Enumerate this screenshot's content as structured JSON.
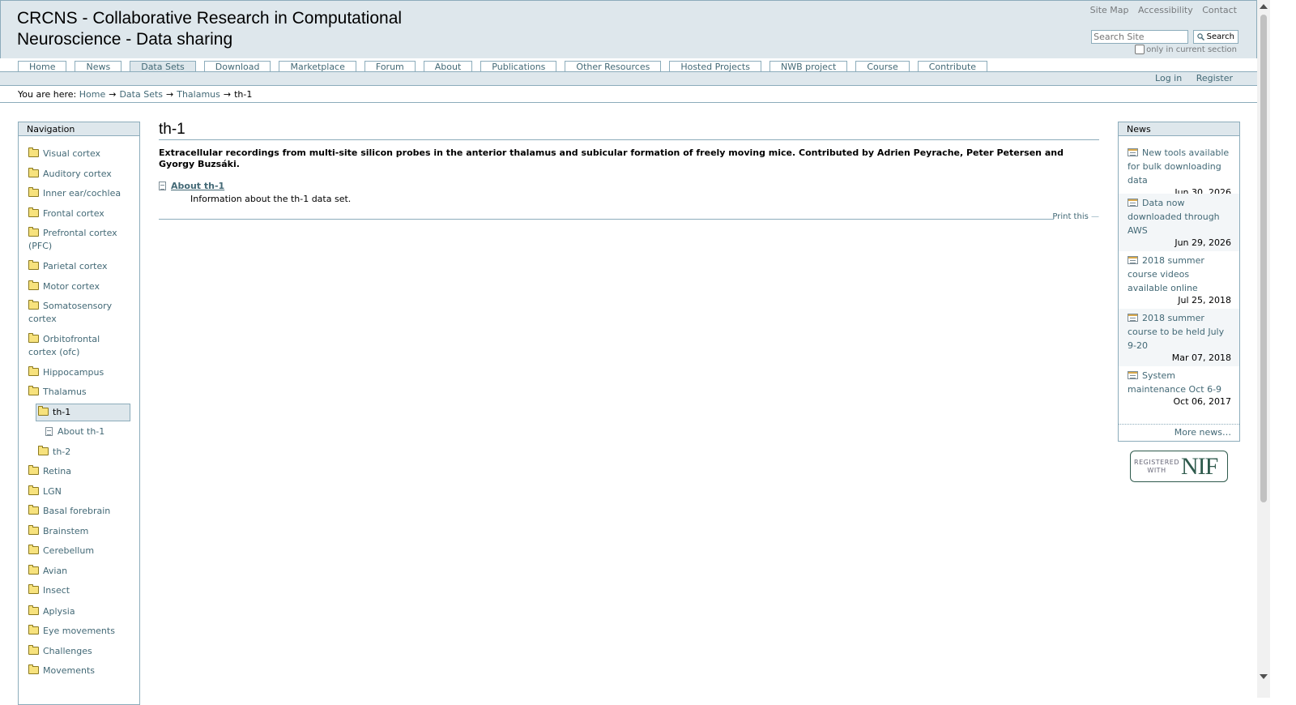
{
  "site": {
    "title": "CRCNS - Collaborative Research in Computational Neuroscience - Data sharing",
    "actions": [
      "Site Map",
      "Accessibility",
      "Contact"
    ],
    "search_placeholder": "Search Site",
    "search_button": "Search",
    "search_option": "only in current section"
  },
  "tabs": [
    "Home",
    "News",
    "Data Sets",
    "Download",
    "Marketplace",
    "Forum",
    "About",
    "Publications",
    "Other Resources",
    "Hosted Projects",
    "NWB project",
    "Course",
    "Contribute"
  ],
  "selected_tab": "Data Sets",
  "personal_bar": {
    "login": "Log in",
    "register": "Register"
  },
  "breadcrumb": {
    "label": "You are here:",
    "items": [
      "Home",
      "Data Sets",
      "Thalamus",
      "th-1"
    ],
    "separator": "→"
  },
  "navigation": {
    "header": "Navigation",
    "items": [
      "Visual cortex",
      "Auditory cortex",
      "Inner ear/cochlea",
      "Frontal cortex",
      "Prefrontal cortex (PFC)",
      "Parietal cortex",
      "Motor cortex",
      "Somatosensory cortex",
      "Orbitofrontal cortex (ofc)",
      "Hippocampus",
      "Thalamus",
      "th-1",
      "About th-1",
      "th-2",
      "Retina",
      "LGN",
      "Basal forebrain",
      "Brainstem",
      "Cerebellum",
      "Avian",
      "Insect",
      "Aplysia",
      "Eye movements",
      "Challenges",
      "Movements"
    ]
  },
  "content": {
    "title": "th-1",
    "description": "Extracellular recordings from multi-site silicon probes in the anterior thalamus and subicular formation of freely moving mice. Contributed by Adrien Peyrache, Peter Petersen and Gyorgy Buzsáki.",
    "about_link": "About th-1",
    "about_description": "Information about the th-1 data set.",
    "print_label": "Print this"
  },
  "news": {
    "header": "News",
    "items": [
      {
        "title": "New tools available for bulk downloading data",
        "date": "Jun 30, 2026"
      },
      {
        "title": "Data now downloaded through AWS",
        "date": "Jun 29, 2026"
      },
      {
        "title": "2018 summer course videos available online",
        "date": "Jul 25, 2018"
      },
      {
        "title": "2018 summer course to be held July 9-20",
        "date": "Mar 07, 2018"
      },
      {
        "title": "System maintenance Oct 6-9",
        "date": "Oct 06, 2017"
      }
    ],
    "more": "More news…"
  },
  "badge": {
    "small": "REGISTERED WITH",
    "big": "NIF"
  },
  "colors": {
    "accent": "#436976",
    "border": "#8cacbb",
    "header_bg": "#dee7ec"
  }
}
